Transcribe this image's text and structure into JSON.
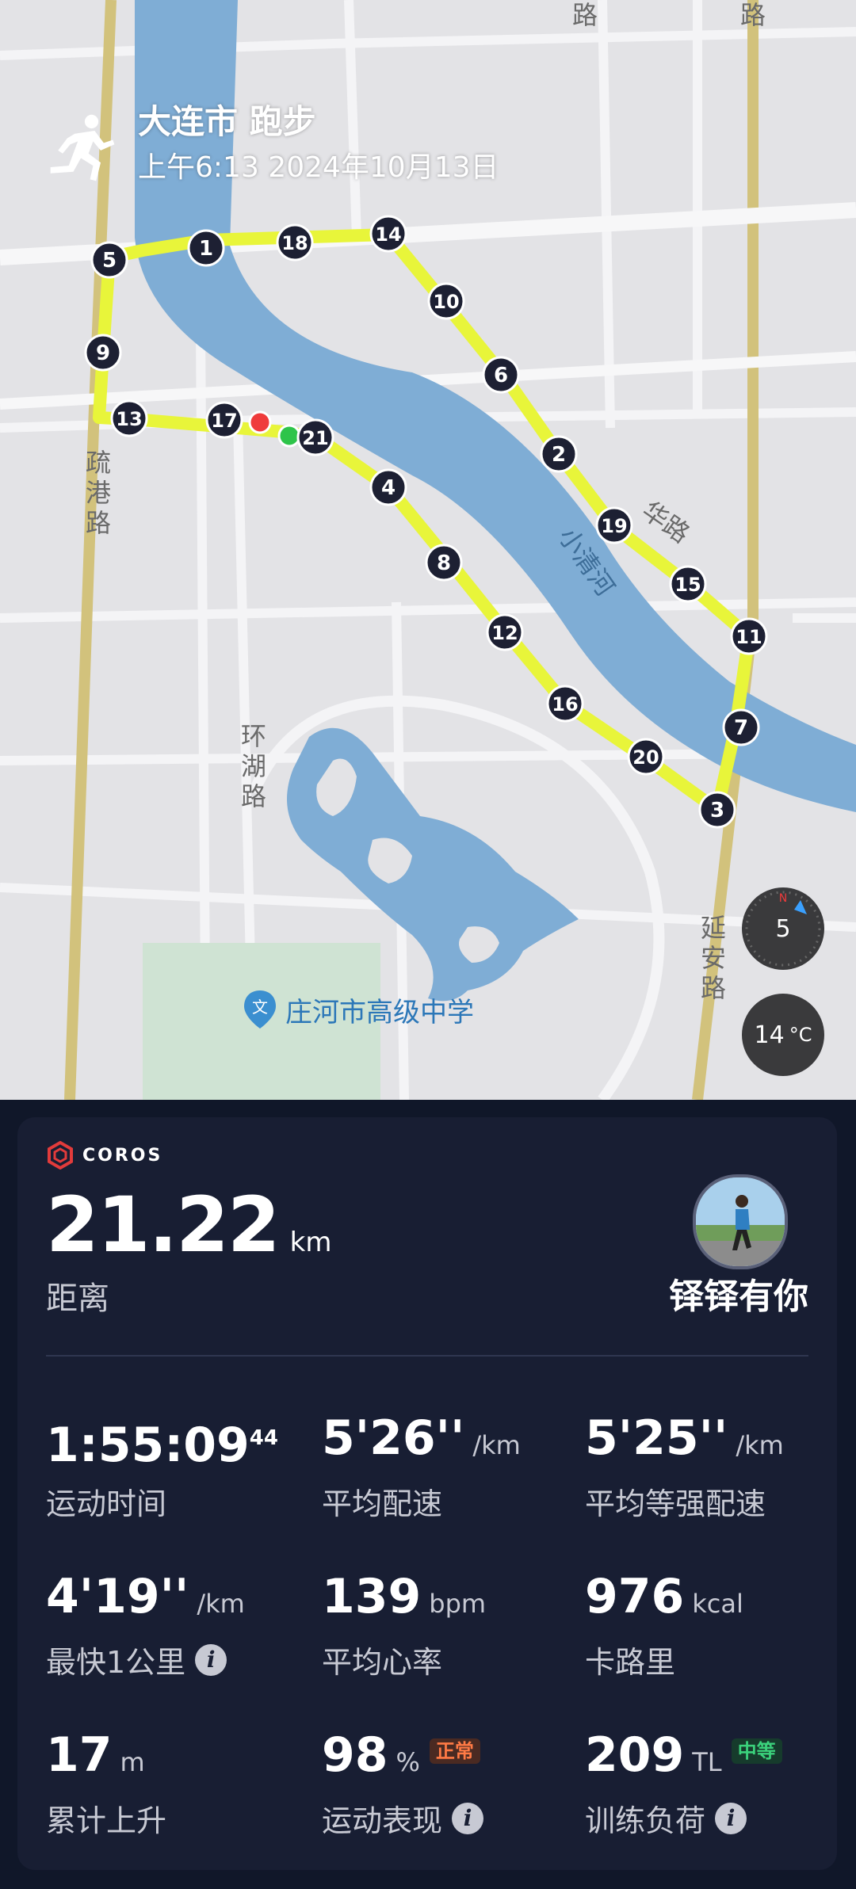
{
  "header": {
    "title": "大连市 跑步",
    "datetime": "上午6:13 2024年10月13日"
  },
  "map": {
    "roads": [
      "路",
      "疏港路",
      "环湖路",
      "延安路",
      "路",
      "华路"
    ],
    "river": "小清河",
    "school": "庄河市高级中学",
    "compass_value": "5",
    "temperature": "14",
    "temperature_unit": "°C",
    "markers": [
      "1",
      "2",
      "3",
      "4",
      "5",
      "6",
      "7",
      "8",
      "9",
      "10",
      "11",
      "12",
      "13",
      "14",
      "15",
      "16",
      "17",
      "18",
      "19",
      "20",
      "21"
    ],
    "route_color": "#e8f53a"
  },
  "brand": "COROS",
  "distance": {
    "value": "21.22",
    "unit": "km",
    "label": "距离"
  },
  "user": {
    "name": "铎铎有你"
  },
  "stats": [
    {
      "value": "1:55:09",
      "sup": "44",
      "unit": "",
      "label": "运动时间"
    },
    {
      "value": "5'26''",
      "unit": "/km",
      "label": "平均配速"
    },
    {
      "value": "5'25''",
      "unit": "/km",
      "label": "平均等强配速"
    },
    {
      "value": "4'19''",
      "unit": "/km",
      "label": "最快1公里",
      "info": "i"
    },
    {
      "value": "139",
      "unit": "bpm",
      "label": "平均心率"
    },
    {
      "value": "976",
      "unit": "kcal",
      "label": "卡路里"
    },
    {
      "value": "17",
      "unit": "m",
      "label": "累计上升"
    },
    {
      "value": "98",
      "unit": "%",
      "label": "运动表现",
      "badge": "正常",
      "info": "i"
    },
    {
      "value": "209",
      "unit": "TL",
      "label": "训练负荷",
      "badge": "中等",
      "info": "i"
    }
  ]
}
